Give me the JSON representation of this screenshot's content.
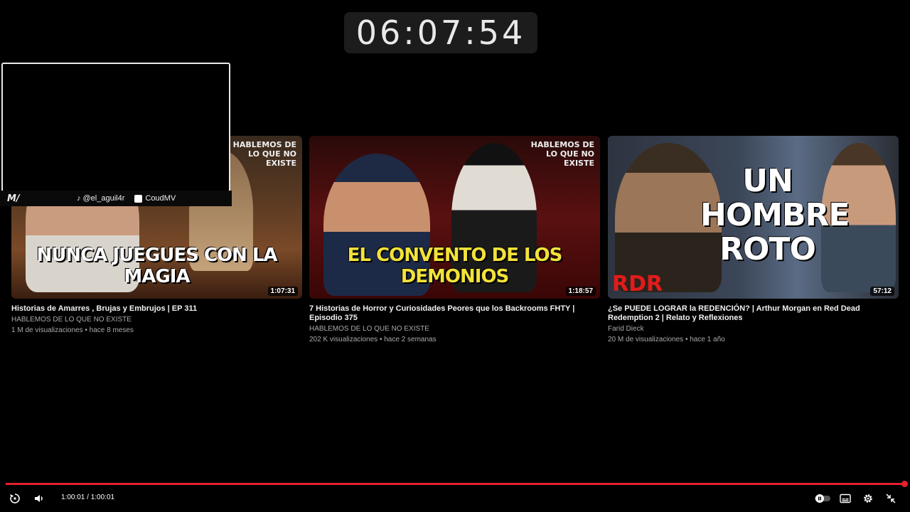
{
  "clock": {
    "time": "06:07:54"
  },
  "overlay": {
    "logo": "M/",
    "tiktok_handle": "@el_aguil4r",
    "kick_handle": "CoudMV"
  },
  "videos": [
    {
      "thumb_headline": "NUNCA JUEGUES CON LA MAGIA",
      "thumb_mark": "HABLEMOS DE LO QUE NO EXISTE",
      "duration": "1:07:31",
      "title": "Historias de Amarres , Brujas y Embrujos | EP 311",
      "channel": "HABLEMOS DE LO QUE NO EXISTE",
      "meta": "1 M de visualizaciones • hace 8 meses"
    },
    {
      "thumb_headline": "EL CONVENTO DE LOS DEMONIOS",
      "thumb_mark": "HABLEMOS DE LO QUE NO EXISTE",
      "duration": "1:18:57",
      "title": "7 Historias de Horror y Curiosidades Peores que los Backrooms FHTY | Episodio 375",
      "channel": "HABLEMOS DE LO QUE NO EXISTE",
      "meta": "202 K visualizaciones • hace 2 semanas"
    },
    {
      "thumb_headline": "UN HOMBRE ROTO",
      "thumb_mark": "RDR",
      "duration": "57:12",
      "title": "¿Se PUEDE LOGRAR la REDENCIÓN? | Arthur Morgan en Red Dead Redemption 2 | Relato y Reflexiones",
      "channel": "Farid Dieck",
      "meta": "20 M de visualizaciones • hace 1 año"
    }
  ],
  "player": {
    "time_readout": "1:00:01 / 1:00:01",
    "progress_fraction": 1.0,
    "accent_color": "#e5202e",
    "icons": [
      "replay-icon",
      "volume-icon",
      "autoplay-toggle-icon",
      "subtitles-icon",
      "settings-icon",
      "exit-fullscreen-icon"
    ]
  }
}
